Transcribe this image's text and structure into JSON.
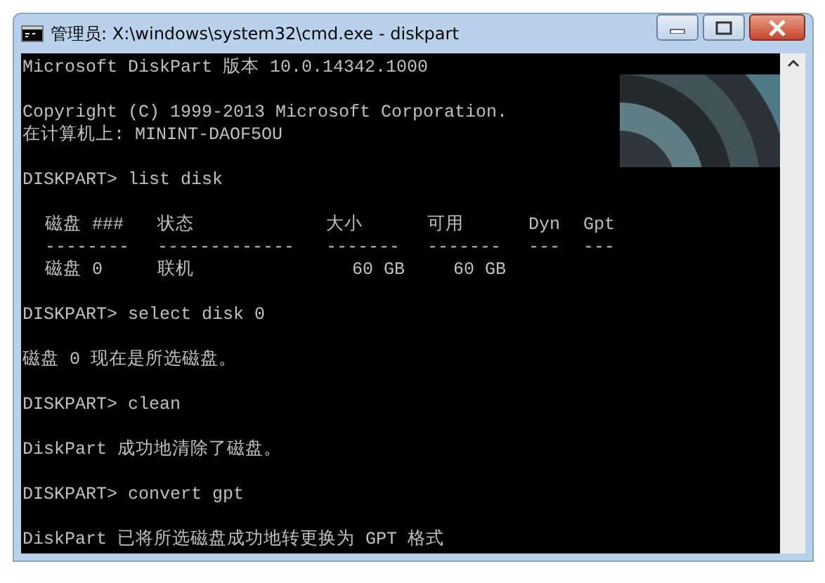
{
  "window": {
    "title": "管理员: X:\\windows\\system32\\cmd.exe - diskpart"
  },
  "console": {
    "lines_before": [
      {
        "kind": "text",
        "text": "Microsoft DiskPart 版本 10.0.14342.1000"
      },
      {
        "kind": "blank"
      },
      {
        "kind": "text",
        "text": "Copyright (C) 1999-2013 Microsoft Corporation."
      },
      {
        "kind": "text",
        "text": "在计算机上: MININT-DAOF5OU"
      },
      {
        "kind": "blank"
      },
      {
        "kind": "text",
        "text": "DISKPART> list disk"
      },
      {
        "kind": "blank"
      }
    ],
    "table": {
      "columns": [
        "磁盘 ###",
        "状态",
        "大小",
        "可用",
        "Dyn",
        "Gpt"
      ],
      "separators": [
        "--------",
        "-------------",
        "-------",
        "-------",
        "---",
        "---"
      ],
      "rows": [
        {
          "cells": [
            "磁盘 0",
            "联机",
            "60 GB",
            "60 GB"
          ]
        }
      ]
    },
    "lines_after": [
      {
        "kind": "blank"
      },
      {
        "kind": "text",
        "text": "DISKPART> select disk 0"
      },
      {
        "kind": "blank"
      },
      {
        "kind": "text",
        "text": "磁盘 0 现在是所选磁盘。"
      },
      {
        "kind": "blank"
      },
      {
        "kind": "text",
        "text": "DISKPART> clean"
      },
      {
        "kind": "blank"
      },
      {
        "kind": "text",
        "text": "DiskPart 成功地清除了磁盘。"
      },
      {
        "kind": "blank"
      },
      {
        "kind": "text",
        "text": "DISKPART> convert gpt"
      },
      {
        "kind": "blank"
      },
      {
        "kind": "text",
        "text": "DiskPart 已将所选磁盘成功地转更换为 GPT 格式"
      }
    ]
  }
}
